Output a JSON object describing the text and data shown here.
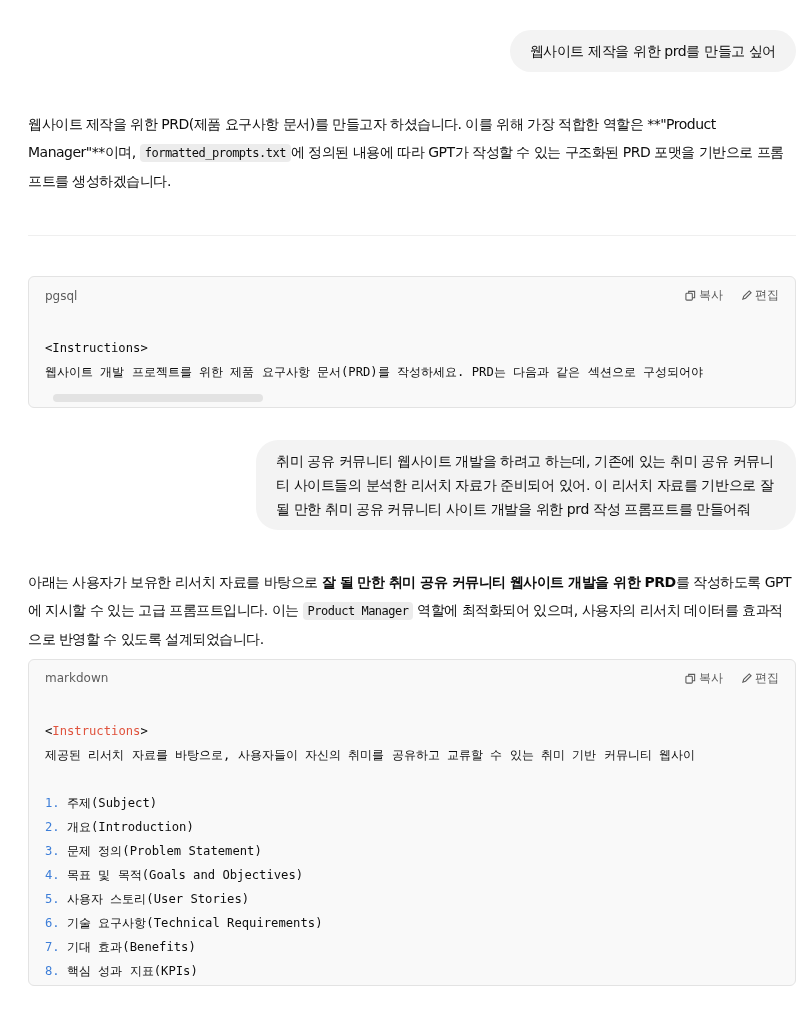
{
  "messages": [
    {
      "kind": "user",
      "text": "웹사이트 제작을 위한 prd를 만들고 싶어"
    },
    {
      "kind": "assistant",
      "segments": [
        {
          "kind": "text",
          "text": "웹사이트 제작을 위한 PRD(제품 요구사항 문서)를 만들고자 하셨습니다. 이를 위해 가장 적합한 역할은 **\"Product Manager\"**이며, "
        },
        {
          "kind": "code",
          "text": "formatted_prompts.txt"
        },
        {
          "kind": "text",
          "text": "에 정의된 내용에 따라 GPT가 작성할 수 있는 구조화된 PRD 포맷을 기반으로 프롬프트를 생성하겠습니다."
        }
      ]
    },
    {
      "kind": "divider"
    },
    {
      "kind": "codeblock",
      "language": "pgsql",
      "copy": "복사",
      "edit": "편집",
      "scrollbar": true,
      "lines": [
        {
          "kind": "blank"
        },
        {
          "kind": "plain",
          "text": "<Instructions>"
        },
        {
          "kind": "plain",
          "text": "웹사이트 개발 프로젝트를 위한 제품 요구사항 문서(PRD)를 작성하세요. PRD는 다음과 같은 섹션으로 구성되어야"
        }
      ]
    },
    {
      "kind": "user",
      "text": "취미 공유 커뮤니티 웹사이트 개발을 하려고 하는데, 기존에 있는 취미 공유 커뮤니티 사이트들의 분석한 리서치 자료가 준비되어 있어. 이 리서치 자료를 기반으로 잘 될 만한 취미 공유 커뮤니티 사이트 개발을 위한 prd 작성 프롬프트를 만들어줘"
    },
    {
      "kind": "assistant",
      "segments": [
        {
          "kind": "text",
          "text": "아래는 사용자가 보유한 리서치 자료를 바탕으로 "
        },
        {
          "kind": "bold",
          "text": "잘 될 만한 취미 공유 커뮤니티 웹사이트 개발을 위한 PRD"
        },
        {
          "kind": "text",
          "text": "를 작성하도록 GPT에 지시할 수 있는 고급 프롬프트입니다. 이는 "
        },
        {
          "kind": "code",
          "text": "Product Manager"
        },
        {
          "kind": "text",
          "text": " 역할에 최적화되어 있으며, 사용자의 리서치 데이터를 효과적으로 반영할 수 있도록 설계되었습니다."
        }
      ]
    },
    {
      "kind": "codeblock",
      "language": "markdown",
      "copy": "복사",
      "edit": "편집",
      "scrollbar": false,
      "lines": [
        {
          "kind": "blank"
        },
        {
          "kind": "tag",
          "open": "<",
          "name": "Instructions",
          "close": ">"
        },
        {
          "kind": "plain",
          "text": "제공된 리서치 자료를 바탕으로, 사용자들이 자신의 취미를 공유하고 교류할 수 있는 취미 기반 커뮤니티 웹사이"
        },
        {
          "kind": "blank"
        },
        {
          "kind": "numbered",
          "number": "1.",
          "text": "주제(Subject)"
        },
        {
          "kind": "numbered",
          "number": "2.",
          "text": "개요(Introduction)"
        },
        {
          "kind": "numbered",
          "number": "3.",
          "text": "문제 정의(Problem Statement)"
        },
        {
          "kind": "numbered",
          "number": "4.",
          "text": "목표 및 목적(Goals and Objectives)"
        },
        {
          "kind": "numbered",
          "number": "5.",
          "text": "사용자 스토리(User Stories)"
        },
        {
          "kind": "numbered",
          "number": "6.",
          "text": "기술 요구사항(Technical Requirements)"
        },
        {
          "kind": "numbered",
          "number": "7.",
          "text": "기대 효과(Benefits)"
        },
        {
          "kind": "numbered",
          "number": "8.",
          "text": "핵심 성과 지표(KPIs)"
        }
      ]
    }
  ]
}
